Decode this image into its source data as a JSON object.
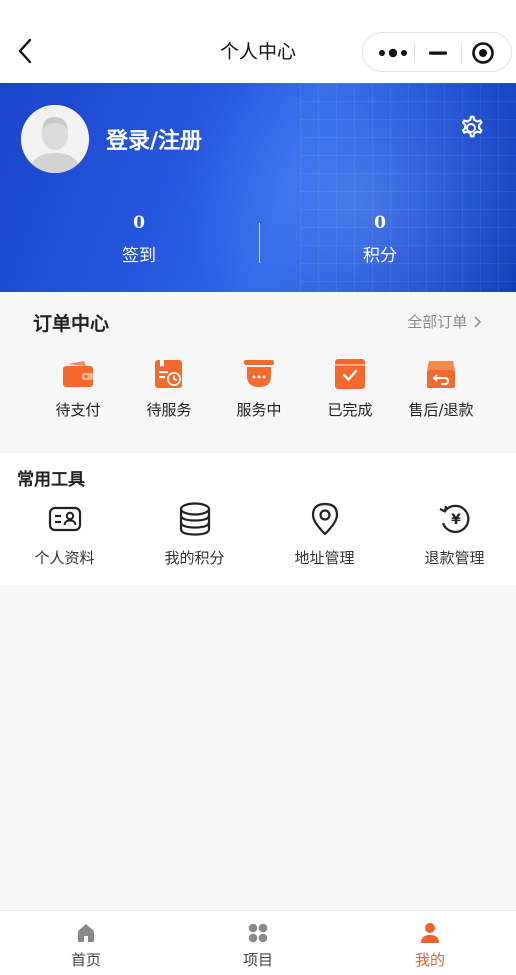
{
  "navbar": {
    "title": "个人中心",
    "back_icon": "chevron-left-icon",
    "menu_icons": [
      "more-dots-icon",
      "minimize-icon",
      "close-target-icon"
    ]
  },
  "profile": {
    "login_label": "登录/注册",
    "avatar_icon": "user-avatar-icon",
    "settings_icon": "gear-icon",
    "stats": [
      {
        "value": "0",
        "label": "签到"
      },
      {
        "value": "0",
        "label": "积分"
      }
    ]
  },
  "orders": {
    "title": "订单中心",
    "all_label": "全部订单",
    "items": [
      {
        "label": "待支付",
        "icon": "wallet-icon"
      },
      {
        "label": "待服务",
        "icon": "calendar-clock-icon"
      },
      {
        "label": "服务中",
        "icon": "service-bell-icon"
      },
      {
        "label": "已完成",
        "icon": "check-box-icon"
      },
      {
        "label": "售后/退款",
        "icon": "return-box-icon"
      }
    ],
    "accent": "#f5692d"
  },
  "tools": {
    "title": "常用工具",
    "items": [
      {
        "label": "个人资料",
        "icon": "id-card-icon"
      },
      {
        "label": "我的积分",
        "icon": "coins-stack-icon"
      },
      {
        "label": "地址管理",
        "icon": "location-pin-icon"
      },
      {
        "label": "退款管理",
        "icon": "refund-yen-icon"
      }
    ]
  },
  "tabbar": {
    "items": [
      {
        "label": "首页",
        "icon": "home-icon",
        "active": false
      },
      {
        "label": "项目",
        "icon": "grid-dots-icon",
        "active": false
      },
      {
        "label": "我的",
        "icon": "person-icon",
        "active": true
      }
    ],
    "active_color": "#f0612b"
  }
}
